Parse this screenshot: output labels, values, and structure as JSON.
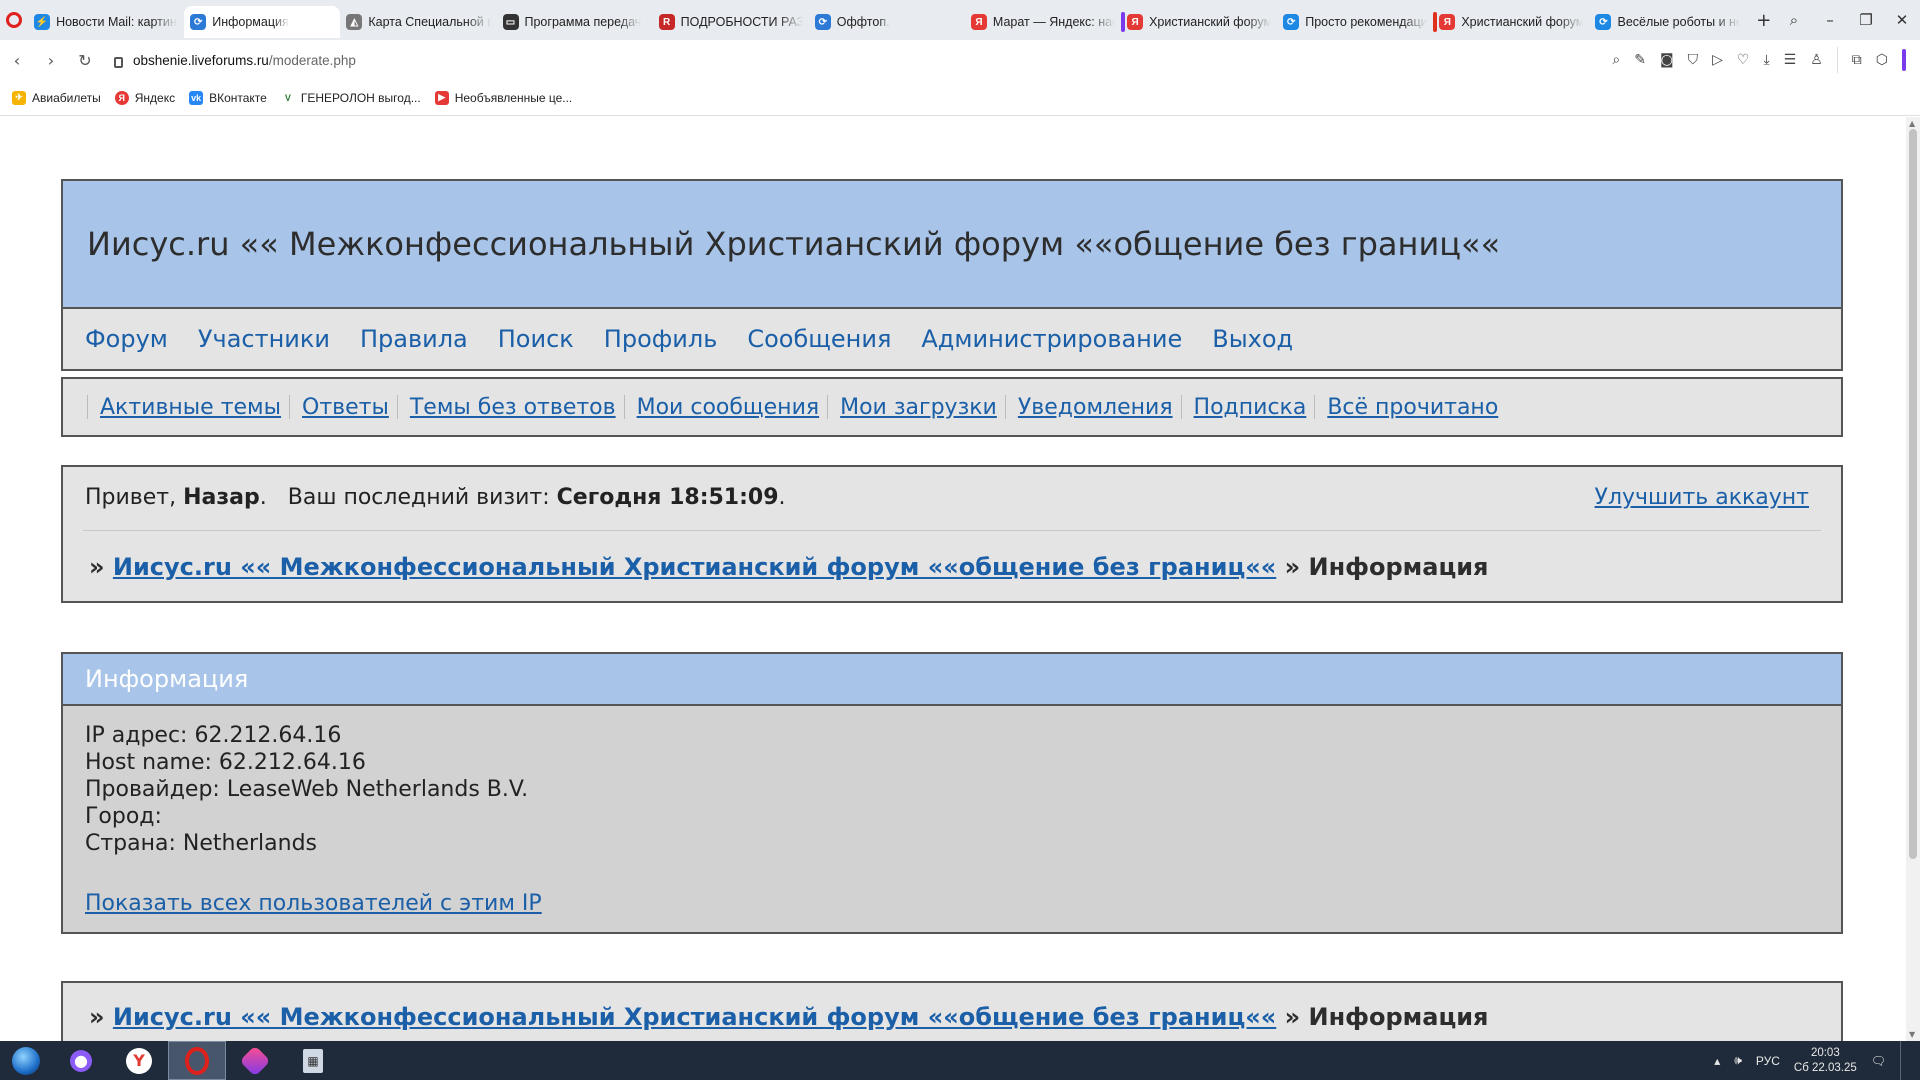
{
  "browser": {
    "tabs": [
      {
        "title": "Новости Mail: картин",
        "favicon": "mail-news-icon",
        "color": "#1e88e5"
      },
      {
        "title": "Информация",
        "favicon": "liveforums-icon",
        "color": "#2d7ad6",
        "active": true
      },
      {
        "title": "Карта Специальной в",
        "favicon": "map-icon",
        "color": "#777777"
      },
      {
        "title": "Программа передач",
        "favicon": "tv-icon",
        "color": "#333333"
      },
      {
        "title": "ПОДРОБНОСТИ РАЗГ",
        "favicon": "r-news-icon",
        "color": "#c62828"
      },
      {
        "title": "Оффтоп.",
        "favicon": "liveforums-icon",
        "color": "#2d7ad6"
      },
      {
        "title": "Марат — Яндекс: нас",
        "favicon": "yandex-icon",
        "color": "#e53935"
      },
      {
        "title": "Христианский форум",
        "favicon": "yandex-icon",
        "color": "#e53935",
        "marker": "purple"
      },
      {
        "title": "Просто рекомендаци",
        "favicon": "liveforums-icon",
        "color": "#1e88e5"
      },
      {
        "title": "Христианский форум",
        "favicon": "yandex-icon",
        "color": "#e53935",
        "marker": "red"
      },
      {
        "title": "Весёлые роботы и не",
        "favicon": "liveforums-icon",
        "color": "#1e88e5"
      }
    ],
    "url_domain": "obshenie.liveforums.ru",
    "url_path": "/moderate.php",
    "bookmarks": [
      {
        "label": "Авиабилеты",
        "icon": "plane-tickets-icon",
        "color": "#f4b400"
      },
      {
        "label": "Яндекс",
        "icon": "yandex-icon",
        "color": "#e53935"
      },
      {
        "label": "ВКонтакте",
        "icon": "vk-icon",
        "color": "#2787f5"
      },
      {
        "label": "ГЕНЕРОЛОН выгод...",
        "icon": "v-icon",
        "color": "#2e7d32"
      },
      {
        "label": "Необъявленные це...",
        "icon": "youtube-icon",
        "color": "#e53935"
      }
    ]
  },
  "forum": {
    "title": "Иисус.ru «« Межконфессиональный Христианский форум ««общение без границ««",
    "main_nav": [
      "Форум",
      "Участники",
      "Правила",
      "Поиск",
      "Профиль",
      "Сообщения",
      "Администрирование",
      "Выход"
    ],
    "sub_nav": [
      "Активные темы",
      "Ответы",
      "Темы без ответов",
      "Мои сообщения",
      "Мои загрузки",
      "Уведомления",
      "Подписка",
      "Всё прочитано"
    ],
    "welcome": {
      "greeting": "Привет,",
      "username": "Назар",
      "last_visit_label": "Ваш последний визит:",
      "last_visit_value": "Сегодня 18:51:09",
      "upgrade": "Улучшить аккаунт"
    },
    "breadcrumb": {
      "prefix": "»",
      "forum_link": "Иисус.ru «« Межконфессиональный Христианский форум ««общение без границ««",
      "separator": "»",
      "current": "Информация"
    },
    "info": {
      "heading": "Информация",
      "ip_label": "IP адрес:",
      "ip_value": "62.212.64.16",
      "host_label": "Host name:",
      "host_value": "62.212.64.16",
      "provider_label": "Провайдер:",
      "provider_value": "LeaseWeb Netherlands B.V.",
      "city_label": "Город:",
      "city_value": "",
      "country_label": "Страна:",
      "country_value": "Netherlands",
      "show_all": "Показать всех пользователей с этим IP"
    }
  },
  "taskbar": {
    "language": "РУС",
    "time": "20:03",
    "date": "Сб 22.03.25"
  }
}
